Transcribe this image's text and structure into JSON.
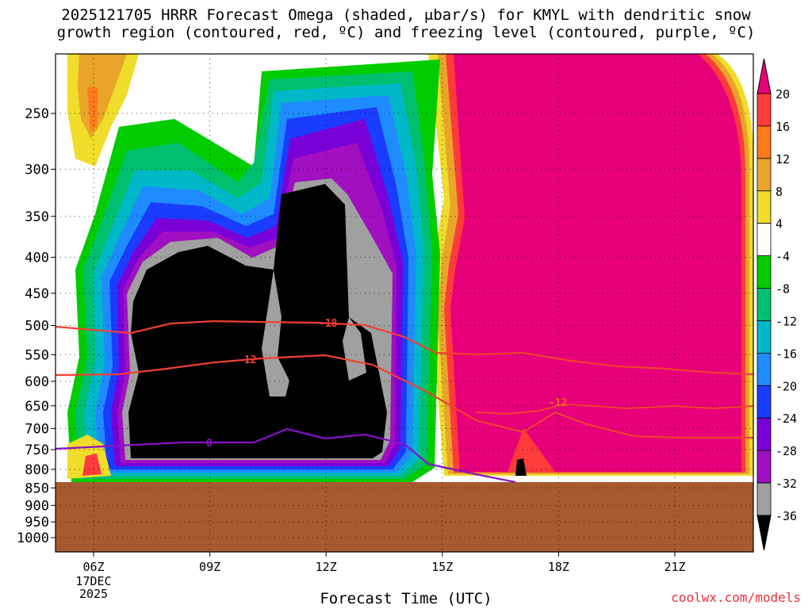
{
  "title_line1": "2025121705 HRRR Forecast Omega (shaded, μbar/s) for KMYL with dendritic snow",
  "title_line2": "growth region (contoured, red, ºC) and freezing level (contoured, purple, ºC)",
  "watermark": "coolwx.com/models",
  "chart_data": {
    "type": "heatmap",
    "xlabel": "Forecast Time (UTC)",
    "ylabel": "",
    "x_ticks": [
      "06Z",
      "09Z",
      "12Z",
      "15Z",
      "18Z",
      "21Z"
    ],
    "x_tick_sub": [
      "17DEC",
      "2025"
    ],
    "y_ticks": [
      250,
      300,
      350,
      400,
      450,
      500,
      550,
      600,
      650,
      700,
      750,
      800,
      850,
      900,
      950,
      1000
    ],
    "y_axis": "pressure (hPa), inverted",
    "colorbar": {
      "labels": [
        "20",
        "16",
        "12",
        "8",
        "4",
        "-4",
        "-8",
        "-12",
        "-16",
        "-20",
        "-24",
        "-28",
        "-32",
        "-36"
      ],
      "colors": [
        "#e8007a",
        "#ff3b3b",
        "#ff7a1a",
        "#e8a52a",
        "#f0dc2a",
        "#ffffff",
        "#00cc00",
        "#00c070",
        "#00b8c8",
        "#1e8cff",
        "#1a3cff",
        "#7a00d8",
        "#a010c0",
        "#a0a0a0",
        "#000000"
      ]
    },
    "contour_labels": {
      "dgz": [
        "-18",
        "-12",
        "-12"
      ],
      "freezing": [
        "0"
      ]
    },
    "surface_fill_color": "#a65a2e",
    "dgz_color": "#f04030",
    "freezing_color": "#8a10c8"
  }
}
